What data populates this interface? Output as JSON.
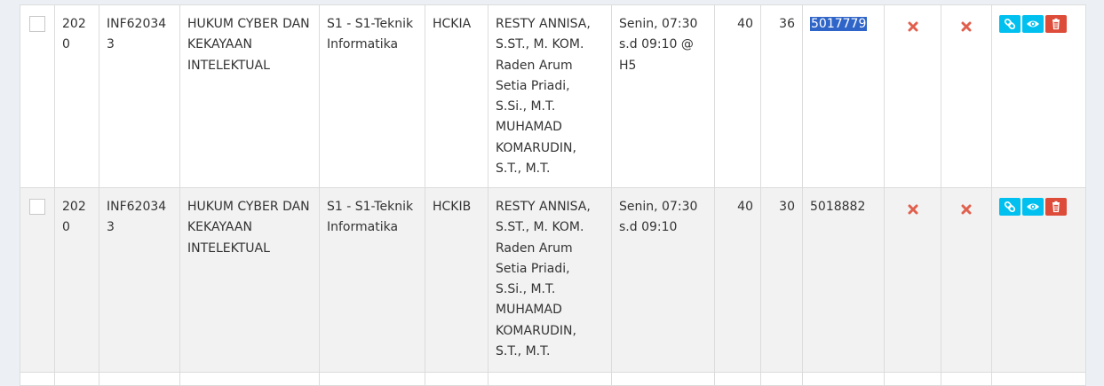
{
  "colors": {
    "info": "#00c0ef",
    "danger": "#dd4b39",
    "x_mark": "#e0604d",
    "selection": "#2f65c8"
  },
  "rows": [
    {
      "year": "2020",
      "code": "INF620343",
      "course_lines": [
        "HUKUM CYBER DAN",
        "KEKAYAAN",
        "INTELEKTUAL"
      ],
      "program_lines": [
        "S1 - S1-Teknik",
        "Informatika"
      ],
      "class": "HCKIA",
      "lecturer_lines": [
        "RESTY ANNISA,",
        "S.ST., M. KOM.",
        "Raden Arum",
        "Setia Priadi,",
        "S.Si., M.T.",
        "MUHAMAD",
        "KOMARUDIN,",
        "S.T., M.T."
      ],
      "schedule_lines": [
        "Senin, 07:30",
        "s.d 09:10 @",
        "H5"
      ],
      "capacity": "40",
      "enrolled": "36",
      "id": "5017779",
      "id_selected": true,
      "flag1_icon": "x-icon",
      "flag2_icon": "x-icon"
    },
    {
      "year": "2020",
      "code": "INF620343",
      "course_lines": [
        "HUKUM CYBER DAN",
        "KEKAYAAN",
        "INTELEKTUAL"
      ],
      "program_lines": [
        "S1 - S1-Teknik",
        "Informatika"
      ],
      "class": "HCKIB",
      "lecturer_lines": [
        "RESTY ANNISA,",
        "S.ST., M. KOM.",
        "Raden Arum",
        "Setia Priadi,",
        "S.Si., M.T.",
        "MUHAMAD",
        "KOMARUDIN,",
        "S.T., M.T."
      ],
      "schedule_lines": [
        "Senin, 07:30",
        "s.d 09:10"
      ],
      "capacity": "40",
      "enrolled": "30",
      "id": "5018882",
      "id_selected": false,
      "flag1_icon": "x-icon",
      "flag2_icon": "x-icon"
    }
  ],
  "action_icons": [
    "link-icon",
    "eye-icon",
    "trash-icon"
  ]
}
